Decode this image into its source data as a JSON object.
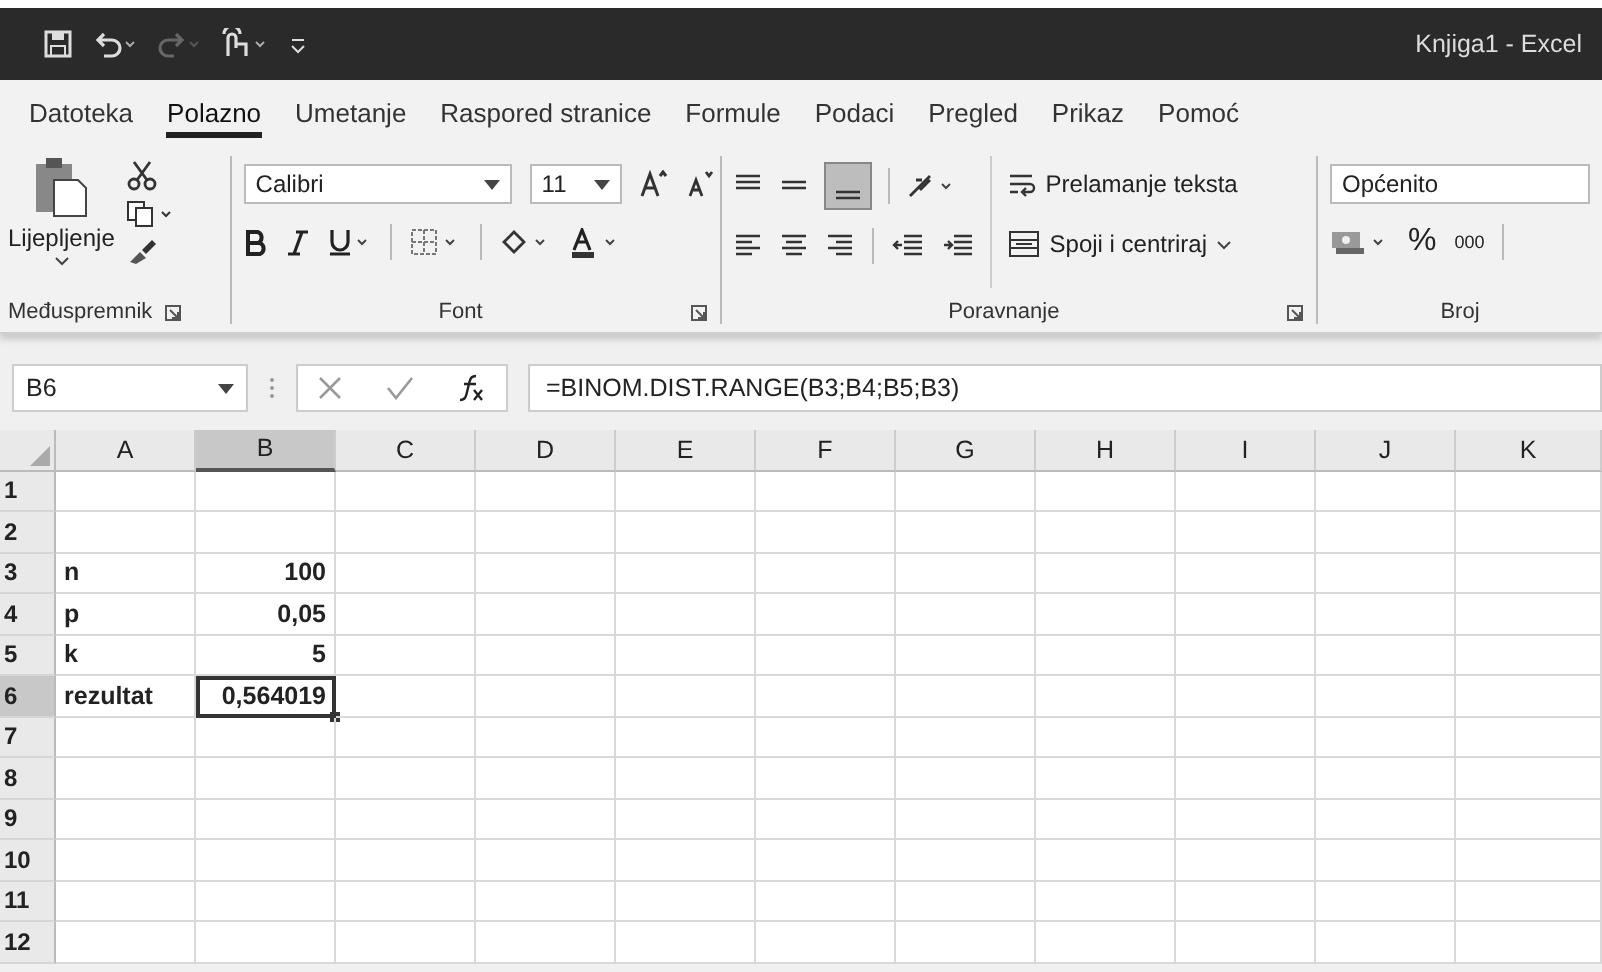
{
  "window": {
    "title": "Knjiga1 - Excel"
  },
  "tabs": [
    {
      "label": "Datoteka",
      "selected": false
    },
    {
      "label": "Polazno",
      "selected": true
    },
    {
      "label": "Umetanje",
      "selected": false
    },
    {
      "label": "Raspored stranice",
      "selected": false
    },
    {
      "label": "Formule",
      "selected": false
    },
    {
      "label": "Podaci",
      "selected": false
    },
    {
      "label": "Pregled",
      "selected": false
    },
    {
      "label": "Prikaz",
      "selected": false
    },
    {
      "label": "Pomoć",
      "selected": false
    }
  ],
  "ribbon": {
    "clipboard": {
      "paste_label": "Lijepljenje",
      "group_label": "Međuspremnik"
    },
    "font": {
      "font_name": "Calibri",
      "font_size": "11",
      "group_label": "Font"
    },
    "alignment": {
      "wrap_label": "Prelamanje teksta",
      "merge_label": "Spoji i centriraj",
      "group_label": "Poravnanje",
      "bottom_align_on": true
    },
    "number": {
      "format": "Općenito",
      "percent": "%",
      "thousands": "000",
      "group_label": "Broj"
    }
  },
  "name_box": "B6",
  "formula": "=BINOM.DIST.RANGE(B3;B4;B5;B3)",
  "columns": [
    {
      "label": "A",
      "selected": false
    },
    {
      "label": "B",
      "selected": true
    },
    {
      "label": "C",
      "selected": false
    },
    {
      "label": "D",
      "selected": false
    },
    {
      "label": "E",
      "selected": false
    },
    {
      "label": "F",
      "selected": false
    },
    {
      "label": "G",
      "selected": false
    },
    {
      "label": "H",
      "selected": false
    },
    {
      "label": "I",
      "selected": false
    },
    {
      "label": "J",
      "selected": false
    },
    {
      "label": "K",
      "selected": false
    }
  ],
  "rows": [
    {
      "label": "1",
      "selected": false,
      "cells": []
    },
    {
      "label": "2",
      "selected": false,
      "cells": []
    },
    {
      "label": "3",
      "selected": false,
      "cells": [
        {
          "text": "n",
          "kind": "text",
          "selected": false
        },
        {
          "text": "100",
          "kind": "number",
          "selected": false
        }
      ]
    },
    {
      "label": "4",
      "selected": false,
      "cells": [
        {
          "text": "p",
          "kind": "text",
          "selected": false
        },
        {
          "text": "0,05",
          "kind": "number",
          "selected": false
        }
      ]
    },
    {
      "label": "5",
      "selected": false,
      "cells": [
        {
          "text": "k",
          "kind": "text",
          "selected": false
        },
        {
          "text": "5",
          "kind": "number",
          "selected": false
        }
      ]
    },
    {
      "label": "6",
      "selected": true,
      "cells": [
        {
          "text": "rezultat",
          "kind": "text",
          "selected": false
        },
        {
          "text": "0,564019",
          "kind": "number",
          "selected": true
        }
      ]
    },
    {
      "label": "7",
      "selected": false,
      "cells": []
    },
    {
      "label": "8",
      "selected": false,
      "cells": []
    },
    {
      "label": "9",
      "selected": false,
      "cells": []
    },
    {
      "label": "10",
      "selected": false,
      "cells": []
    },
    {
      "label": "11",
      "selected": false,
      "cells": []
    },
    {
      "label": "12",
      "selected": false,
      "cells": []
    }
  ]
}
